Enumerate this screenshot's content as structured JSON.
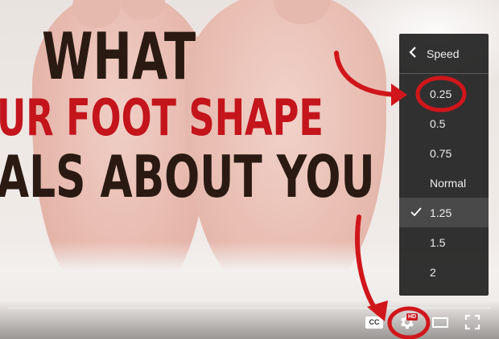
{
  "video": {
    "headline": {
      "line1": "WHAT",
      "line2": "UR FOOT SHAPE",
      "line3": "ALS ABOUT YOU"
    }
  },
  "player": {
    "controls": {
      "cc_label": "CC",
      "hd_badge": "HD"
    },
    "speed_menu": {
      "title": "Speed",
      "back_icon": "chevron-left-icon",
      "options": [
        {
          "label": "0.25",
          "selected": false
        },
        {
          "label": "0.5",
          "selected": false
        },
        {
          "label": "0.75",
          "selected": false
        },
        {
          "label": "Normal",
          "selected": false
        },
        {
          "label": "1.25",
          "selected": true
        },
        {
          "label": "1.5",
          "selected": false
        },
        {
          "label": "2",
          "selected": false
        }
      ]
    }
  },
  "annotation_color": "#d0161b",
  "menu_background": "#1c1c1c",
  "headline_dark_color": "#2a1a12",
  "headline_red_color": "#c4141c"
}
